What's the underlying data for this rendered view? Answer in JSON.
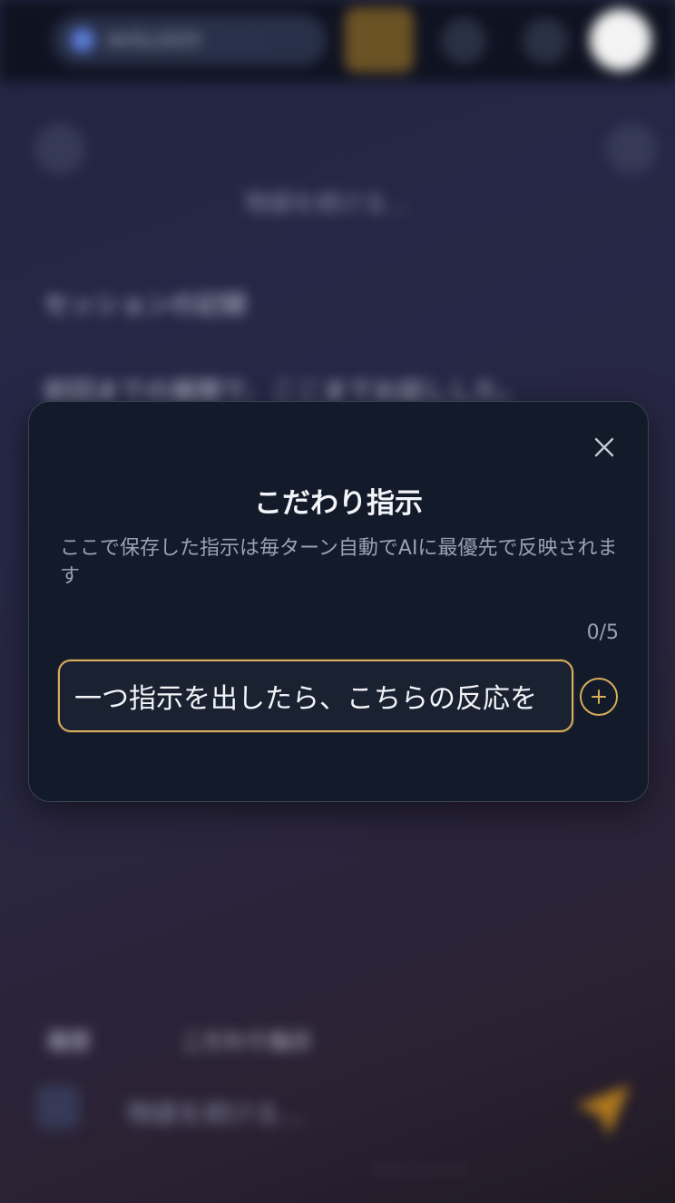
{
  "background": {
    "model_pill_text": "AI/GL2025",
    "model_pill_suffix": "・・・",
    "title_line": "物語を続ける…",
    "heading": "セッションの記録",
    "subtext": "前回までの展開で、ここまでお話しした。",
    "tool_a": "履歴",
    "tool_b": "こだわり指示",
    "input_placeholder": "物語を続ける…",
    "footer_note": "・・・・・・"
  },
  "modal": {
    "title": "こだわり指示",
    "description": "ここで保存した指示は毎ターン自動でAIに最優先で反映されます",
    "counter": "0/5",
    "input_value": "一つ指示を出したら、こちらの反応を",
    "close_icon": "close-icon",
    "add_icon": "plus-icon"
  },
  "colors": {
    "accent": "#d9ad5c",
    "modal_bg": "#131a2a",
    "text_primary": "#f2f4f8",
    "text_secondary": "#9aa1b1"
  }
}
